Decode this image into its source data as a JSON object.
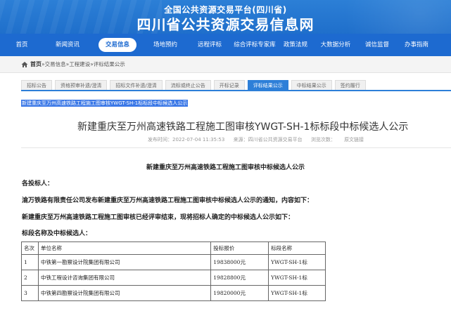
{
  "header": {
    "title_top": "全国公共资源交易平台(四川省)",
    "title_main": "四川省公共资源交易信息网"
  },
  "nav": {
    "items": [
      {
        "label": "首页"
      },
      {
        "label": "新闻资讯"
      },
      {
        "label": "交易信息",
        "active": true
      },
      {
        "label": "场地预约"
      },
      {
        "label": "远程评标"
      },
      {
        "label": "综合评标专家库"
      },
      {
        "label": "政策法规"
      },
      {
        "label": "大数据分析"
      },
      {
        "label": "诚信监督"
      },
      {
        "label": "办事指南"
      }
    ]
  },
  "breadcrumb": {
    "home": "首页",
    "sep1": "»",
    "item1": "交易信息",
    "sep2": "»",
    "item2": "工程建设",
    "sep3": "»",
    "item3": "评标结果公示"
  },
  "subtabs": [
    {
      "label": "招标公告"
    },
    {
      "label": "资格预审补遗/澄清"
    },
    {
      "label": "招标文件补遗/澄清"
    },
    {
      "label": "流标或终止公告"
    },
    {
      "label": "开标记录"
    },
    {
      "label": "评标结果公示",
      "active": true
    },
    {
      "label": "中标结果公示"
    },
    {
      "label": "签约履行"
    }
  ],
  "selected_link": "新建重庆至万州高速铁路工程施工图审核YWGT-SH-1标标段中标候选人公示",
  "article": {
    "title": "新建重庆至万州高速铁路工程施工图审核YWGT-SH-1标标段中标候选人公示",
    "meta_time": "发布时间：2022-07-04 11:35:53",
    "meta_source": "来源：四川省公共资源交易平台",
    "meta_views": "浏览次数：",
    "meta_original": "原文链接"
  },
  "body": {
    "heading": "新建重庆至万州高速铁路工程施工图审核中标候选人公示",
    "greeting": "各投标人：",
    "para1": "渝万铁路有限责任公司发布新建重庆至万州高速铁路工程施工图审核中标候选人公示的通知，内容如下：",
    "para2": "新建重庆至万州高速铁路工程施工图审核已经评审结束，现将招标人确定的中标候选人公示如下：",
    "para3": "标段名称及中标候选人："
  },
  "table": {
    "headers": [
      "名次",
      "单位名称",
      "投标报价",
      "标段名称"
    ],
    "rows": [
      [
        "1",
        "中铁第一勘察设计院集团有限公司",
        "19838000元",
        "YWGT-SH-1标"
      ],
      [
        "2",
        "中铁工程设计咨询集团有限公司",
        "19828800元",
        "YWGT-SH-1标"
      ],
      [
        "3",
        "中铁第四勘察设计院集团有限公司",
        "19820000元",
        "YWGT-SH-1标"
      ]
    ]
  },
  "colors": {
    "header_blue": "#1f6fcb",
    "nav_blue": "#1d6ad0",
    "tab_active": "#2d7fd8",
    "selection": "#3b78e7"
  }
}
